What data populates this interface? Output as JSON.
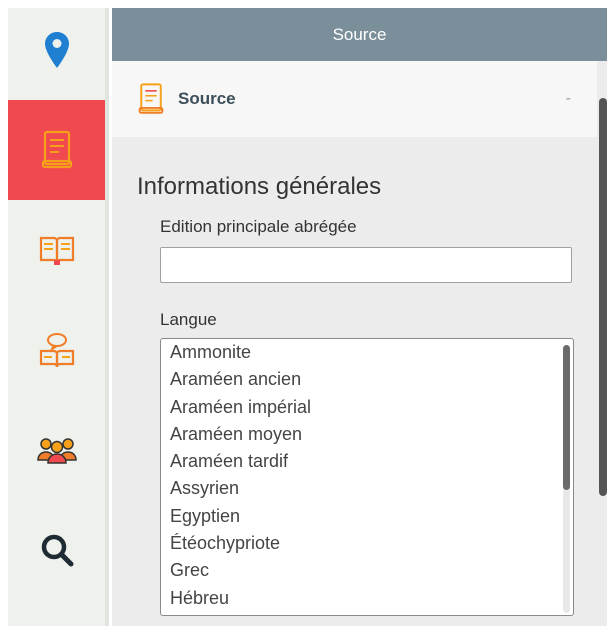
{
  "sidebar": {
    "items": [
      {
        "icon": "map-pin-icon",
        "active": false
      },
      {
        "icon": "document-book-icon",
        "active": true
      },
      {
        "icon": "open-book-icon",
        "active": false
      },
      {
        "icon": "book-speech-icon",
        "active": false
      },
      {
        "icon": "people-group-icon",
        "active": false
      },
      {
        "icon": "search-icon",
        "active": false
      }
    ],
    "active_color": "#f0494f"
  },
  "header": {
    "title": "Source"
  },
  "section": {
    "icon": "document-book-icon",
    "title": "Source",
    "collapse_label": "-"
  },
  "form": {
    "group_title": "Informations générales",
    "edition_label": "Edition principale abrégée",
    "edition_value": "",
    "langue_label": "Langue",
    "langue_options": [
      "Ammonite",
      "Araméen ancien",
      "Araméen impérial",
      "Araméen moyen",
      "Araméen tardif",
      "Assyrien",
      "Egyptien",
      "Étéochypriote",
      "Grec",
      "Hébreu"
    ]
  }
}
